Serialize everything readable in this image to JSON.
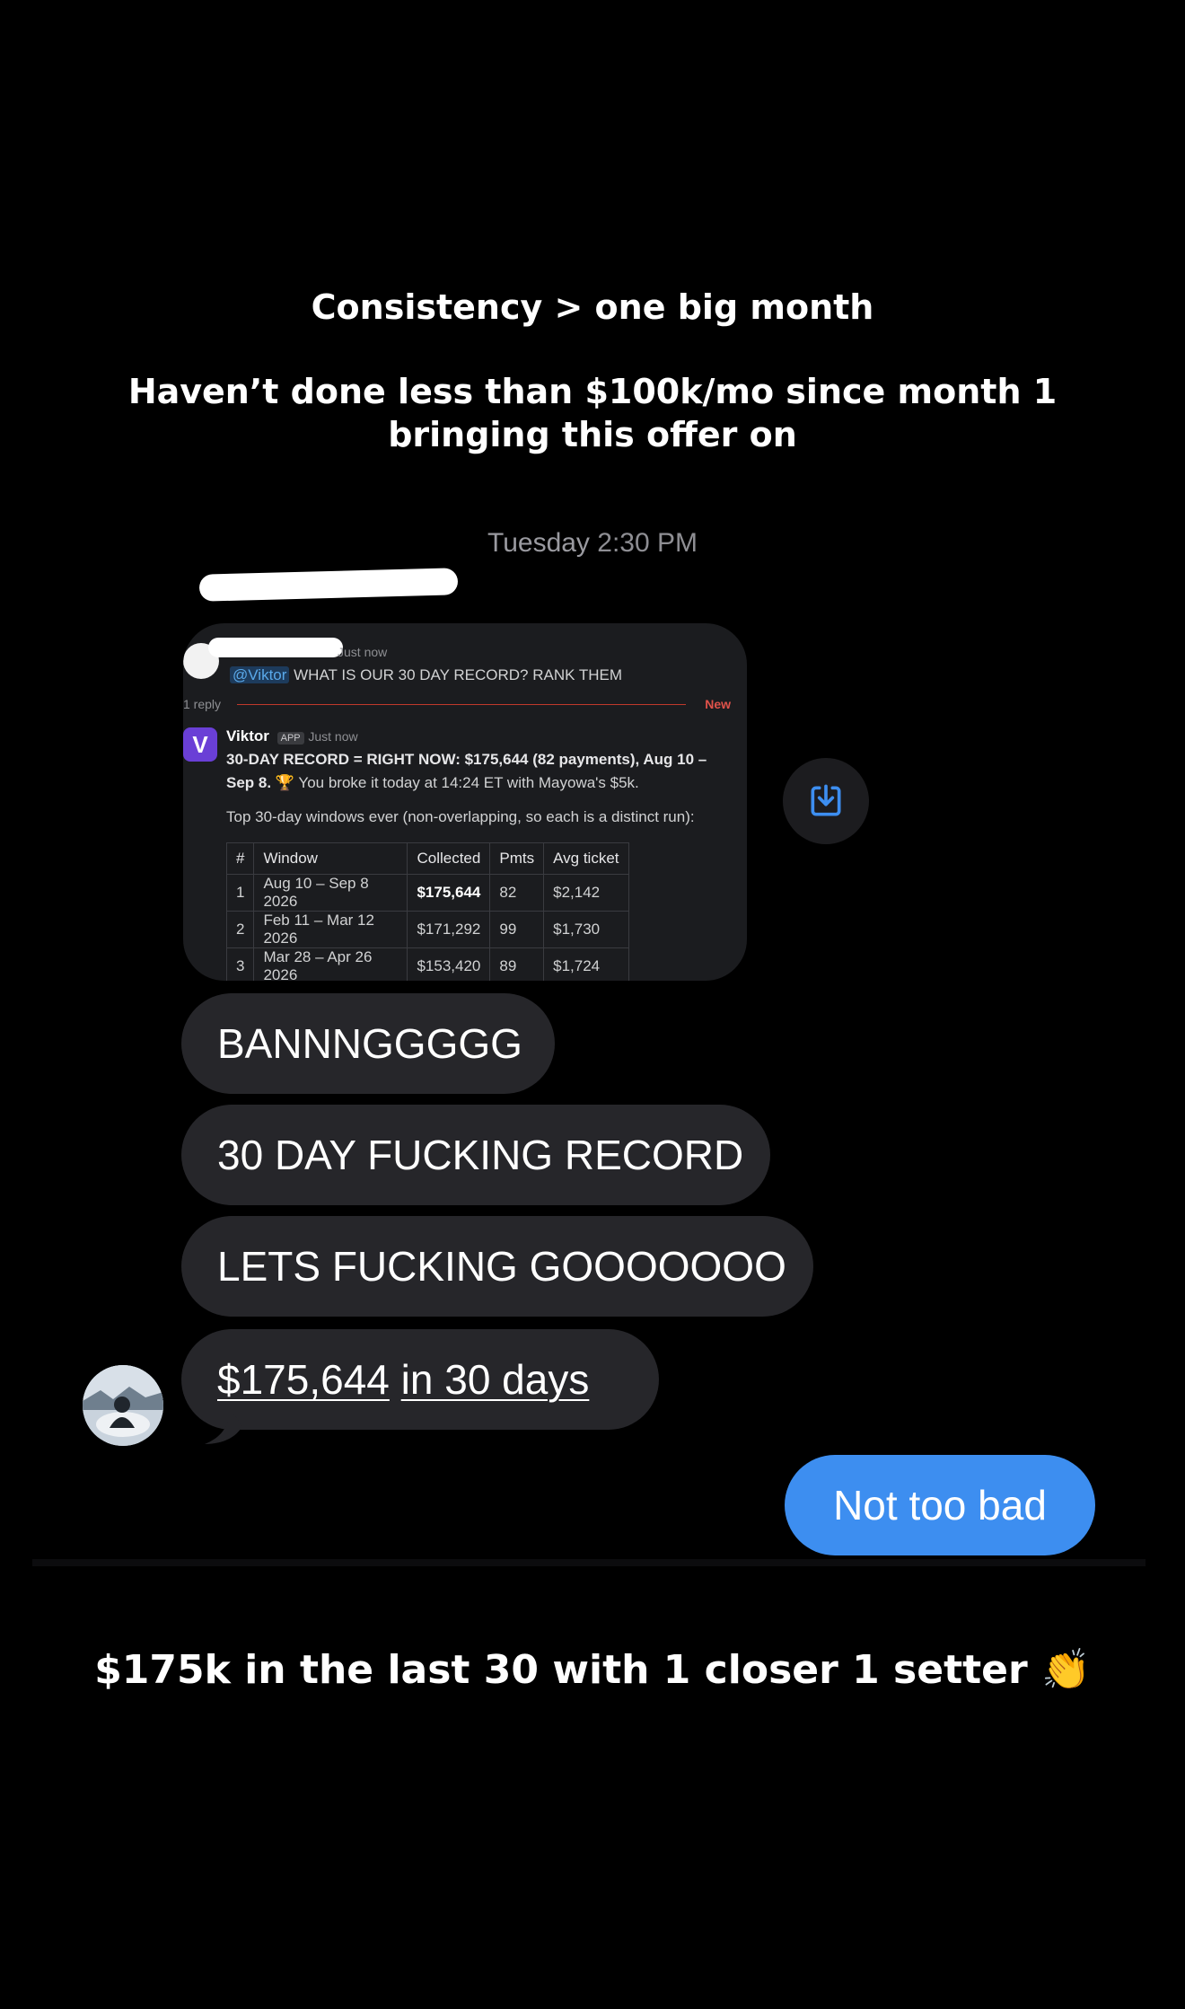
{
  "captions": {
    "line1": "Consistency > one big month",
    "line2a": "Haven’t done less than $100k/mo since month 1",
    "line2b": "bringing this offer on",
    "bottom": "$175k in the last 30 with 1 closer 1 setter 👏"
  },
  "chat": {
    "timestamp_day": "Tuesday",
    "timestamp_time": "2:30 PM",
    "screenshot": {
      "first_msg_time": "Just now",
      "mention": "@Viktor",
      "question": "WHAT IS OUR 30 DAY RECORD? RANK THEM",
      "replies": "1 reply",
      "new_label": "New",
      "bot_name": "Viktor",
      "app_badge": "APP",
      "bot_time": "Just now",
      "record_line1": "30-DAY RECORD = RIGHT NOW: $175,644 (82 payments), Aug 10 –",
      "record_line2a": "Sep 8.",
      "record_line2b": "You broke it today at 14:24 ET with Mayowa's $5k.",
      "top_line": "Top 30-day windows ever (non-overlapping, so each is a distinct run):",
      "table_headers": [
        "#",
        "Window",
        "Collected",
        "Pmts",
        "Avg ticket"
      ],
      "table_rows": [
        [
          "1",
          "Aug 10 – Sep 8 2026",
          "$175,644",
          "82",
          "$2,142"
        ],
        [
          "2",
          "Feb 11 – Mar 12 2026",
          "$171,292",
          "99",
          "$1,730"
        ],
        [
          "3",
          "Mar 28 – Apr 26 2026",
          "$153,420",
          "89",
          "$1,724"
        ]
      ]
    },
    "messages": [
      {
        "text": "BANNNGGGGG"
      },
      {
        "text": "30 DAY FUCKING RECORD"
      },
      {
        "text": "LETS FUCKING GOOOOOOO"
      },
      {
        "text_a": "$175,644",
        "text_b": "in 30 days"
      }
    ],
    "reply": "Not too bad"
  }
}
